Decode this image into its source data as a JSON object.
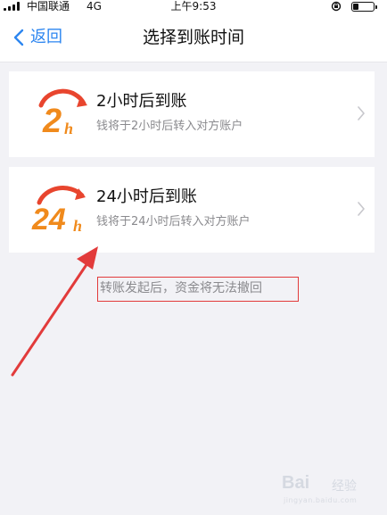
{
  "status_bar": {
    "carrier": "中国联通",
    "network": "4G",
    "time": "上午9:53",
    "battery_level": 0.3
  },
  "nav": {
    "back_label": "返回",
    "title": "选择到账时间"
  },
  "options": [
    {
      "logo_text": "2",
      "logo_suffix": "h",
      "title": "2小时后到账",
      "description": "钱将于2小时后转入对方账户"
    },
    {
      "logo_text": "24",
      "logo_suffix": "h",
      "title": "24小时后到账",
      "description": "钱将于24小时后转入对方账户"
    }
  ],
  "note": "转账发起后，资金将无法撤回",
  "watermark": {
    "latin": "Bai",
    "cn": "经验",
    "url": "jingyan.baidu.com"
  },
  "colors": {
    "accent_blue": "#2d86f0",
    "logo_orange": "#f08a1c",
    "logo_red": "#e8452e",
    "annotation_red": "#e23b3b"
  }
}
